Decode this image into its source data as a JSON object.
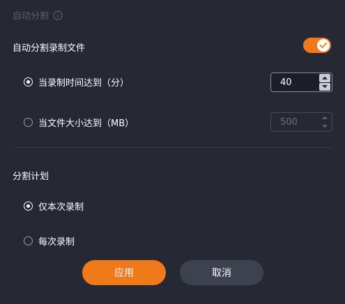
{
  "section": {
    "title": "自动分割",
    "info_icon": "info-circle-icon"
  },
  "auto_split": {
    "label": "自动分割录制文件",
    "enabled": true,
    "accent": "#f07a1a"
  },
  "time_option": {
    "label": "当录制时间达到（分）",
    "checked": true,
    "value": "40"
  },
  "size_option": {
    "label": "当文件大小达到（MB）",
    "checked": false,
    "value": "500"
  },
  "plan": {
    "title": "分割计划",
    "options": [
      {
        "label": "仅本次录制",
        "checked": true
      },
      {
        "label": "每次录制",
        "checked": false
      }
    ]
  },
  "buttons": {
    "apply": "应用",
    "cancel": "取消"
  }
}
